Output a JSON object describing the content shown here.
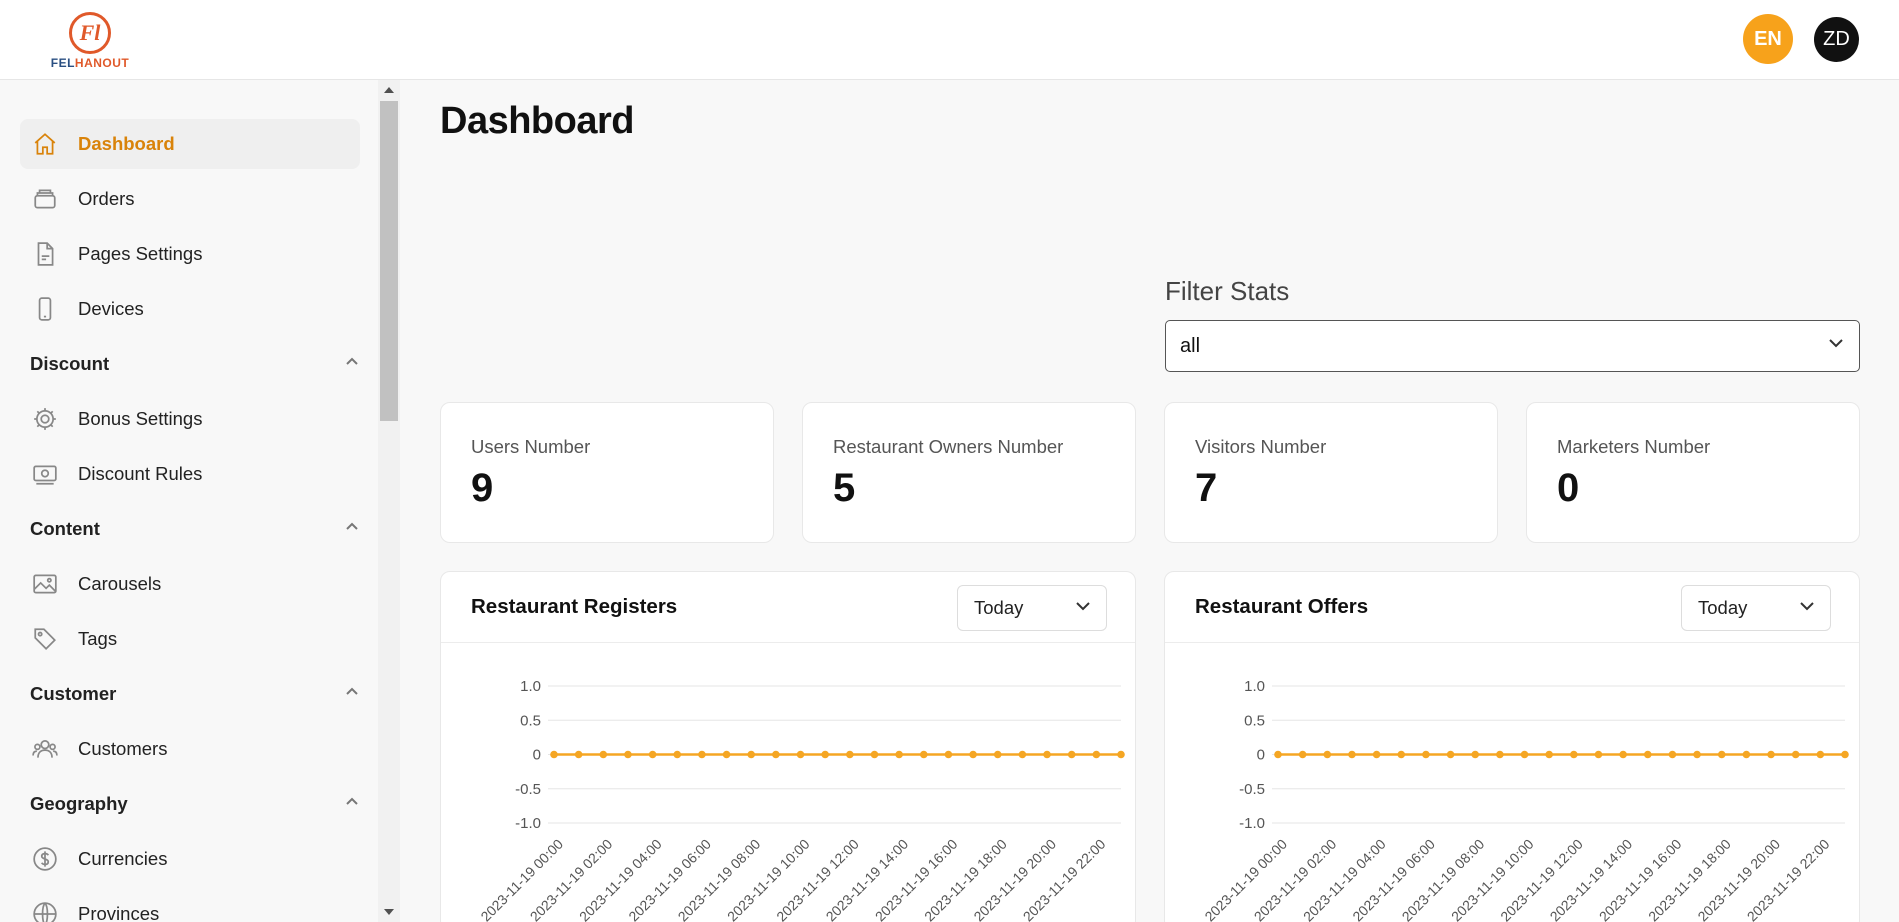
{
  "header": {
    "logo": {
      "mark": "Fl",
      "text_part1": "FEL",
      "text_part2": "HANOUT"
    },
    "language": "EN",
    "user_initials": "ZD"
  },
  "sidebar": {
    "items": [
      {
        "label": "Dashboard",
        "icon": "home-icon",
        "active": true
      },
      {
        "label": "Orders",
        "icon": "orders-icon"
      },
      {
        "label": "Pages Settings",
        "icon": "document-icon"
      },
      {
        "label": "Devices",
        "icon": "mobile-icon"
      }
    ],
    "sections": [
      {
        "label": "Discount",
        "items": [
          {
            "label": "Bonus Settings",
            "icon": "gear-icon"
          },
          {
            "label": "Discount Rules",
            "icon": "cash-icon"
          }
        ]
      },
      {
        "label": "Content",
        "items": [
          {
            "label": "Carousels",
            "icon": "image-icon"
          },
          {
            "label": "Tags",
            "icon": "tag-icon"
          }
        ]
      },
      {
        "label": "Customer",
        "items": [
          {
            "label": "Customers",
            "icon": "users-icon"
          }
        ]
      },
      {
        "label": "Geography",
        "items": [
          {
            "label": "Currencies",
            "icon": "dollar-icon"
          },
          {
            "label": "Provinces",
            "icon": "globe-icon"
          }
        ]
      }
    ]
  },
  "main": {
    "title": "Dashboard",
    "filter": {
      "label": "Filter Stats",
      "value": "all"
    },
    "stats": [
      {
        "label": "Users Number",
        "value": "9"
      },
      {
        "label": "Restaurant Owners Number",
        "value": "5"
      },
      {
        "label": "Visitors Number",
        "value": "7"
      },
      {
        "label": "Marketers Number",
        "value": "0"
      }
    ],
    "charts": [
      {
        "title": "Restaurant Registers",
        "period": "Today"
      },
      {
        "title": "Restaurant Offers",
        "period": "Today"
      }
    ]
  },
  "colors": {
    "accent": "#d9830a",
    "line": "#f5a623",
    "lang_badge": "#f7a21b"
  },
  "chart_data": [
    {
      "type": "line",
      "title": "Restaurant Registers",
      "yticks": [
        "1.0",
        "0.5",
        "0",
        "-0.5",
        "-1.0"
      ],
      "ylim": [
        -1,
        1
      ],
      "x": [
        "2023-11-19 00:00",
        "2023-11-19 01:00",
        "2023-11-19 02:00",
        "2023-11-19 03:00",
        "2023-11-19 04:00",
        "2023-11-19 05:00",
        "2023-11-19 06:00",
        "2023-11-19 07:00",
        "2023-11-19 08:00",
        "2023-11-19 09:00",
        "2023-11-19 10:00",
        "2023-11-19 11:00",
        "2023-11-19 12:00",
        "2023-11-19 13:00",
        "2023-11-19 14:00",
        "2023-11-19 15:00",
        "2023-11-19 16:00",
        "2023-11-19 17:00",
        "2023-11-19 18:00",
        "2023-11-19 19:00",
        "2023-11-19 20:00",
        "2023-11-19 21:00",
        "2023-11-19 22:00",
        "2023-11-19 23:00"
      ],
      "xticks": [
        "2023-11-19 00:00",
        "2023-11-19 02:00",
        "2023-11-19 04:00",
        "2023-11-19 06:00",
        "2023-11-19 08:00",
        "2023-11-19 10:00",
        "2023-11-19 12:00",
        "2023-11-19 14:00",
        "2023-11-19 16:00",
        "2023-11-19 18:00",
        "2023-11-19 20:00",
        "2023-11-19 22:00"
      ],
      "series": [
        {
          "values": [
            0,
            0,
            0,
            0,
            0,
            0,
            0,
            0,
            0,
            0,
            0,
            0,
            0,
            0,
            0,
            0,
            0,
            0,
            0,
            0,
            0,
            0,
            0,
            0
          ]
        }
      ],
      "grid": true
    },
    {
      "type": "line",
      "title": "Restaurant Offers",
      "yticks": [
        "1.0",
        "0.5",
        "0",
        "-0.5",
        "-1.0"
      ],
      "ylim": [
        -1,
        1
      ],
      "x": [
        "2023-11-19 00:00",
        "2023-11-19 01:00",
        "2023-11-19 02:00",
        "2023-11-19 03:00",
        "2023-11-19 04:00",
        "2023-11-19 05:00",
        "2023-11-19 06:00",
        "2023-11-19 07:00",
        "2023-11-19 08:00",
        "2023-11-19 09:00",
        "2023-11-19 10:00",
        "2023-11-19 11:00",
        "2023-11-19 12:00",
        "2023-11-19 13:00",
        "2023-11-19 14:00",
        "2023-11-19 15:00",
        "2023-11-19 16:00",
        "2023-11-19 17:00",
        "2023-11-19 18:00",
        "2023-11-19 19:00",
        "2023-11-19 20:00",
        "2023-11-19 21:00",
        "2023-11-19 22:00",
        "2023-11-19 23:00"
      ],
      "xticks": [
        "2023-11-19 00:00",
        "2023-11-19 02:00",
        "2023-11-19 04:00",
        "2023-11-19 06:00",
        "2023-11-19 08:00",
        "2023-11-19 10:00",
        "2023-11-19 12:00",
        "2023-11-19 14:00",
        "2023-11-19 16:00",
        "2023-11-19 18:00",
        "2023-11-19 20:00",
        "2023-11-19 22:00"
      ],
      "series": [
        {
          "values": [
            0,
            0,
            0,
            0,
            0,
            0,
            0,
            0,
            0,
            0,
            0,
            0,
            0,
            0,
            0,
            0,
            0,
            0,
            0,
            0,
            0,
            0,
            0,
            0
          ]
        }
      ],
      "grid": true
    }
  ]
}
